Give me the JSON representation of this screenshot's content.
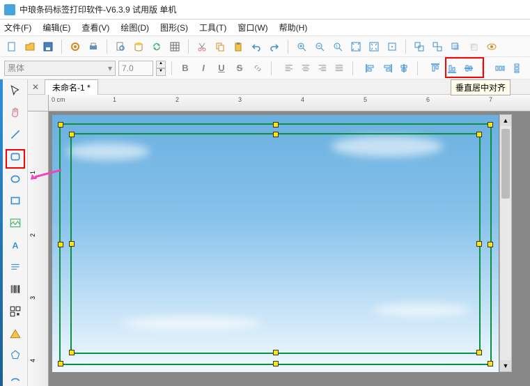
{
  "title": "中琅条码标签打印软件-V6.3.9 试用版 单机",
  "menus": {
    "file": "文件(F)",
    "edit": "编辑(E)",
    "view": "查看(V)",
    "draw": "绘图(D)",
    "shape": "图形(S)",
    "tool": "工具(T)",
    "window": "窗口(W)",
    "help": "帮助(H)"
  },
  "format": {
    "font": "黑体",
    "size": "7.0",
    "bold": "B",
    "italic": "I",
    "underline": "U",
    "strike": "S"
  },
  "tab": {
    "name": "未命名-1 *"
  },
  "ruler": {
    "unit": "0 cm",
    "h": [
      "1",
      "2",
      "3",
      "4",
      "5",
      "6",
      "7"
    ],
    "v": [
      "1",
      "2",
      "3",
      "4"
    ]
  },
  "tooltip": "垂直居中对齐"
}
